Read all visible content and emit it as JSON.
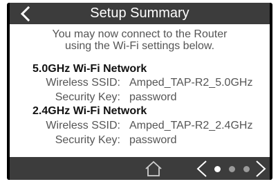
{
  "header": {
    "title": "Setup Summary",
    "back_icon": "chevron-left-icon"
  },
  "intro": {
    "line1": "You may now connect to the Router",
    "line2": "using the Wi-Fi settings below."
  },
  "networks": [
    {
      "title": "5.0GHz Wi-Fi Network",
      "ssid_label": "Wireless SSID:",
      "ssid_value": "Amped_TAP-R2_5.0GHz",
      "key_label": "Security Key:",
      "key_value": "password"
    },
    {
      "title": "2.4GHz Wi-Fi Network",
      "ssid_label": "Wireless SSID:",
      "ssid_value": "Amped_TAP-R2_2.4GHz",
      "key_label": "Security Key:",
      "key_value": "password"
    }
  ],
  "footer": {
    "home_icon": "home-icon",
    "prev_icon": "chevron-left-icon",
    "next_icon": "chevron-right-icon",
    "page_total": 3,
    "page_current": 1,
    "dot_active_color": "#ffffff",
    "dot_inactive_color": "#9a9a9a"
  },
  "colors": {
    "bar": "#3c3c3c",
    "frame": "#000000",
    "text": "#555555",
    "heading": "#111111"
  }
}
